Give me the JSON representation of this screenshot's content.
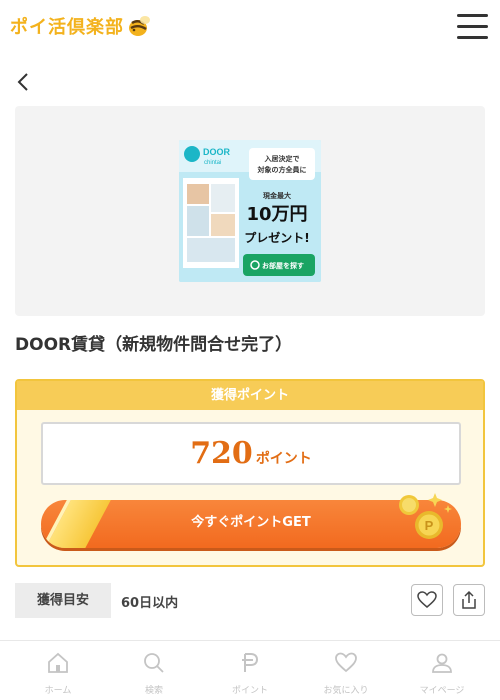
{
  "header": {
    "logo_text": "ポイ活倶楽部"
  },
  "banner": {
    "brand": "DOOR",
    "brand_sub": "chintai",
    "bubble": "入居決定で\n対象の方全員に",
    "cash_label": "現金最大",
    "amount": "10万円",
    "present": "プレゼント!",
    "button": "お部屋を探す"
  },
  "offer": {
    "title": "DOOR賃貸（新規物件問合せ完了）",
    "points_header": "獲得ポイント",
    "points_value": "720",
    "points_unit": "ポイント",
    "cta_label": "今すぐポイントGET",
    "eta_label": "獲得目安",
    "eta_value": "60日以内"
  },
  "nav": {
    "items": [
      {
        "label": "ホーム",
        "icon": "home-icon"
      },
      {
        "label": "検索",
        "icon": "search-icon"
      },
      {
        "label": "ポイント",
        "icon": "point-icon"
      },
      {
        "label": "お気に入り",
        "icon": "heart-icon"
      },
      {
        "label": "マイページ",
        "icon": "user-icon"
      }
    ]
  },
  "colors": {
    "accent_orange": "#f26a1f",
    "gold": "#f7cc57",
    "logo": "#f3b21d"
  }
}
